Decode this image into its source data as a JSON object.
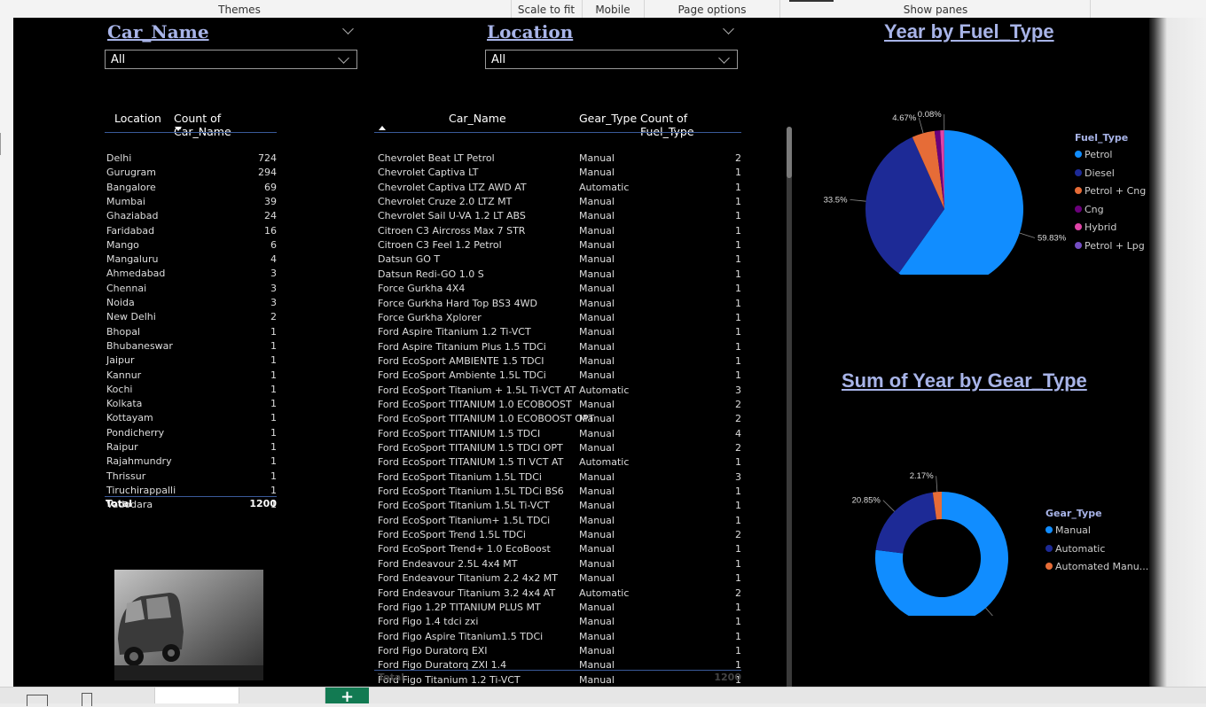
{
  "ribbon": {
    "themes": "Themes",
    "scale_to_fit": "Scale to fit",
    "mobile": "Mobile",
    "page_options": "Page options",
    "show_panes": "Show panes"
  },
  "slicers": {
    "car_name": {
      "title": "Car_Name",
      "value": "All"
    },
    "location": {
      "title": "Location",
      "value": "All"
    }
  },
  "location_table": {
    "headers": [
      "Location",
      "Count of Car_Name"
    ],
    "rows": [
      [
        "Delhi",
        "724"
      ],
      [
        "Gurugram",
        "294"
      ],
      [
        "Bangalore",
        "69"
      ],
      [
        "Mumbai",
        "39"
      ],
      [
        "Ghaziabad",
        "24"
      ],
      [
        "Faridabad",
        "16"
      ],
      [
        "Mango",
        "6"
      ],
      [
        "Mangaluru",
        "4"
      ],
      [
        "Ahmedabad",
        "3"
      ],
      [
        "Chennai",
        "3"
      ],
      [
        "Noida",
        "3"
      ],
      [
        "New Delhi",
        "2"
      ],
      [
        "Bhopal",
        "1"
      ],
      [
        "Bhubaneswar",
        "1"
      ],
      [
        "Jaipur",
        "1"
      ],
      [
        "Kannur",
        "1"
      ],
      [
        "Kochi",
        "1"
      ],
      [
        "Kolkata",
        "1"
      ],
      [
        "Kottayam",
        "1"
      ],
      [
        "Pondicherry",
        "1"
      ],
      [
        "Raipur",
        "1"
      ],
      [
        "Rajahmundry",
        "1"
      ],
      [
        "Thrissur",
        "1"
      ],
      [
        "Tiruchirappalli",
        "1"
      ],
      [
        "Vadodara",
        "1"
      ]
    ],
    "total_label": "Total",
    "total_value": "1200"
  },
  "car_table": {
    "headers": [
      "Car_Name",
      "Gear_Type",
      "Count of Fuel_Type"
    ],
    "rows": [
      [
        "Chevrolet Beat LT Petrol",
        "Manual",
        "2"
      ],
      [
        "Chevrolet Captiva LT",
        "Manual",
        "1"
      ],
      [
        "Chevrolet Captiva LTZ AWD AT",
        "Automatic",
        "1"
      ],
      [
        "Chevrolet Cruze 2.0 LTZ MT",
        "Manual",
        "1"
      ],
      [
        "Chevrolet Sail U-VA 1.2 LT ABS",
        "Manual",
        "1"
      ],
      [
        "Citroen C3 Aircross Max 7 STR",
        "Manual",
        "1"
      ],
      [
        "Citroen C3 Feel 1.2 Petrol",
        "Manual",
        "1"
      ],
      [
        "Datsun GO T",
        "Manual",
        "1"
      ],
      [
        "Datsun Redi-GO 1.0 S",
        "Manual",
        "1"
      ],
      [
        "Force Gurkha 4X4",
        "Manual",
        "1"
      ],
      [
        "Force Gurkha Hard Top BS3 4WD",
        "Manual",
        "1"
      ],
      [
        "Force Gurkha Xplorer",
        "Manual",
        "1"
      ],
      [
        "Ford Aspire Titanium 1.2 Ti-VCT",
        "Manual",
        "1"
      ],
      [
        "Ford Aspire Titanium Plus 1.5 TDCi",
        "Manual",
        "1"
      ],
      [
        "Ford EcoSport AMBIENTE 1.5 TDCI",
        "Manual",
        "1"
      ],
      [
        "Ford EcoSport Ambiente 1.5L TDCi",
        "Manual",
        "1"
      ],
      [
        "Ford EcoSport Titanium + 1.5L Ti-VCT AT",
        "Automatic",
        "3"
      ],
      [
        "Ford EcoSport TITANIUM 1.0 ECOBOOST",
        "Manual",
        "2"
      ],
      [
        "Ford EcoSport TITANIUM 1.0 ECOBOOST OPT",
        "Manual",
        "2"
      ],
      [
        "Ford EcoSport TITANIUM 1.5 TDCI",
        "Manual",
        "4"
      ],
      [
        "Ford EcoSport TITANIUM 1.5 TDCI OPT",
        "Manual",
        "2"
      ],
      [
        "Ford EcoSport TITANIUM 1.5 TI VCT AT",
        "Automatic",
        "1"
      ],
      [
        "Ford EcoSport Titanium 1.5L TDCi",
        "Manual",
        "3"
      ],
      [
        "Ford EcoSport Titanium 1.5L TDCi BS6",
        "Manual",
        "1"
      ],
      [
        "Ford EcoSport Titanium 1.5L Ti-VCT",
        "Manual",
        "1"
      ],
      [
        "Ford EcoSport Titanium+ 1.5L TDCi",
        "Manual",
        "1"
      ],
      [
        "Ford EcoSport Trend 1.5L TDCi",
        "Manual",
        "2"
      ],
      [
        "Ford EcoSport Trend+ 1.0 EcoBoost",
        "Manual",
        "1"
      ],
      [
        "Ford Endeavour 2.5L 4x4 MT",
        "Manual",
        "1"
      ],
      [
        "Ford Endeavour Titanium 2.2 4x2 MT",
        "Manual",
        "1"
      ],
      [
        "Ford Endeavour Titanium 3.2 4x4 AT",
        "Automatic",
        "2"
      ],
      [
        "Ford Figo 1.2P TITANIUM PLUS MT",
        "Manual",
        "1"
      ],
      [
        "Ford Figo 1.4 tdci zxi",
        "Manual",
        "1"
      ],
      [
        "Ford Figo Aspire Titanium1.5 TDCi",
        "Manual",
        "1"
      ],
      [
        "Ford Figo Duratorq EXI",
        "Manual",
        "1"
      ],
      [
        "Ford Figo Duratorq ZXI 1.4",
        "Manual",
        "1"
      ],
      [
        "Ford Figo Titanium 1.2 Ti-VCT",
        "Manual",
        "1"
      ]
    ],
    "total_label": "Total",
    "total_value": "1200"
  },
  "fuel_chart": {
    "title": "Year by Fuel_Type",
    "legend_title": "Fuel_Type",
    "colors": {
      "Petrol": "#118dff",
      "Diesel": "#1d2a96",
      "Petrol + Cng": "#e66c37",
      "Cng": "#6b007b",
      "Hybrid": "#e044a7",
      "Petrol + Lpg": "#744ec2"
    }
  },
  "gear_chart": {
    "title": "Sum of Year by Gear_Type",
    "legend_title": "Gear_Type",
    "colors": {
      "Manual": "#118dff",
      "Automatic": "#1d2a96",
      "Automated Manu...": "#e66c37"
    }
  },
  "chart_data": [
    {
      "type": "pie",
      "title": "Year by Fuel_Type",
      "categories": [
        "Petrol",
        "Diesel",
        "Petrol + Cng",
        "Cng",
        "Hybrid",
        "Petrol + Lpg"
      ],
      "values": [
        59.83,
        33.5,
        4.67,
        1.15,
        0.77,
        0.08
      ],
      "labels": [
        "59.83%",
        "33.5%",
        "4.67%",
        "",
        "",
        "0.08%"
      ],
      "legend": "right"
    },
    {
      "type": "pie",
      "title": "Sum of Year by Gear_Type",
      "categories": [
        "Manual",
        "Automatic",
        "Automated Manu..."
      ],
      "values": [
        76.98,
        20.85,
        2.17
      ],
      "labels": [
        "76.98%",
        "20.85%",
        "2.17%"
      ],
      "legend": "right"
    }
  ]
}
